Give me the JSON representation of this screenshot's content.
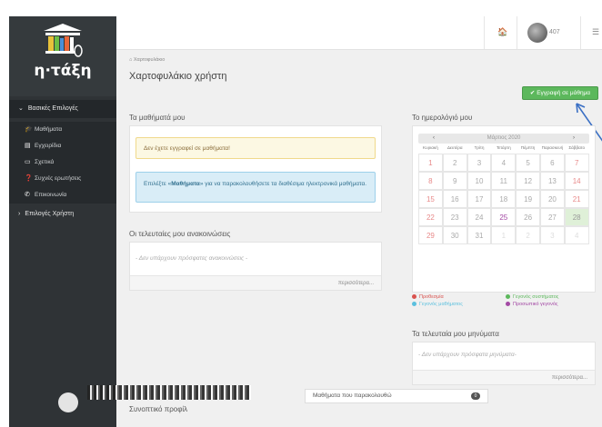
{
  "logo": {
    "text": "η·τάξη"
  },
  "sidebar": {
    "basic_header": "Βασικές Επιλογές",
    "items": [
      {
        "label": "Μαθήματα",
        "icon": "graduation-cap-icon"
      },
      {
        "label": "Εγχειρίδια",
        "icon": "book-icon"
      },
      {
        "label": "Σχετικά",
        "icon": "credit-card-icon"
      },
      {
        "label": "Συχνές ερωτήσεις",
        "icon": "question-circle-icon"
      },
      {
        "label": "Επικοινωνία",
        "icon": "phone-icon"
      }
    ],
    "user_header": "Επιλογές Χρήστη"
  },
  "topbar": {
    "user_suffix": "407"
  },
  "breadcrumb": "Χαρτοφυλάκιο",
  "page_title": "Χαρτοφυλάκιο χρήστη",
  "register_button": "Εγγραφή σε μάθημα",
  "my_courses": {
    "title": "Τα μαθήματά μου",
    "warning": "Δεν έχετε εγγραφεί σε μαθήματα!",
    "info_prefix": "Επιλέξτε «",
    "info_strong": "Μαθήματα",
    "info_suffix": "» για να παρακολουθήσετε τα διαθέσιμα ηλεκτρονικά μαθήματα."
  },
  "announcements": {
    "title": "Οι τελευταίες μου ανακοινώσεις",
    "empty": "- Δεν υπάρχουν πρόσφατες ανακοινώσεις -",
    "more": "περισσότερα..."
  },
  "calendar": {
    "title": "Το ημερολόγιό μου",
    "prev": "‹",
    "next": "›",
    "month": "Μάρτιος 2020",
    "days": [
      "Κυριακή",
      "Δευτέρα",
      "Τρίτη",
      "Τετάρτη",
      "Πέμπτη",
      "Παρασκευή",
      "Σάββατο"
    ],
    "weeks": [
      [
        "1",
        "2",
        "3",
        "4",
        "5",
        "6",
        "7"
      ],
      [
        "8",
        "9",
        "10",
        "11",
        "12",
        "13",
        "14"
      ],
      [
        "15",
        "16",
        "17",
        "18",
        "19",
        "20",
        "21"
      ],
      [
        "22",
        "23",
        "24",
        "25",
        "26",
        "27",
        "28"
      ],
      [
        "29",
        "30",
        "31",
        "1",
        "2",
        "3",
        "4"
      ]
    ],
    "today": "28",
    "legend": [
      {
        "label": "Προθεσμία",
        "color": "#d9534f"
      },
      {
        "label": "Γεγονός συστήματος",
        "color": "#5cb85c"
      },
      {
        "label": "Γεγονός μαθήματος",
        "color": "#5bc0de"
      },
      {
        "label": "Προσωπικό γεγονός",
        "color": "#a349a4"
      }
    ]
  },
  "messages": {
    "title": "Τα τελευταία μου μηνύματα",
    "empty": "- Δεν υπάρχουν πρόσφατα μηνύματα-",
    "more": "περισσότερα..."
  },
  "profile": {
    "title": "Συνοπτικό προφίλ",
    "courses_label": "Μαθήματα που παρακολουθώ",
    "courses_count": "0"
  },
  "colors": {
    "sidebar": "#2f3336",
    "accent_green": "#5cb85c",
    "weekend": "#e88a8a"
  }
}
